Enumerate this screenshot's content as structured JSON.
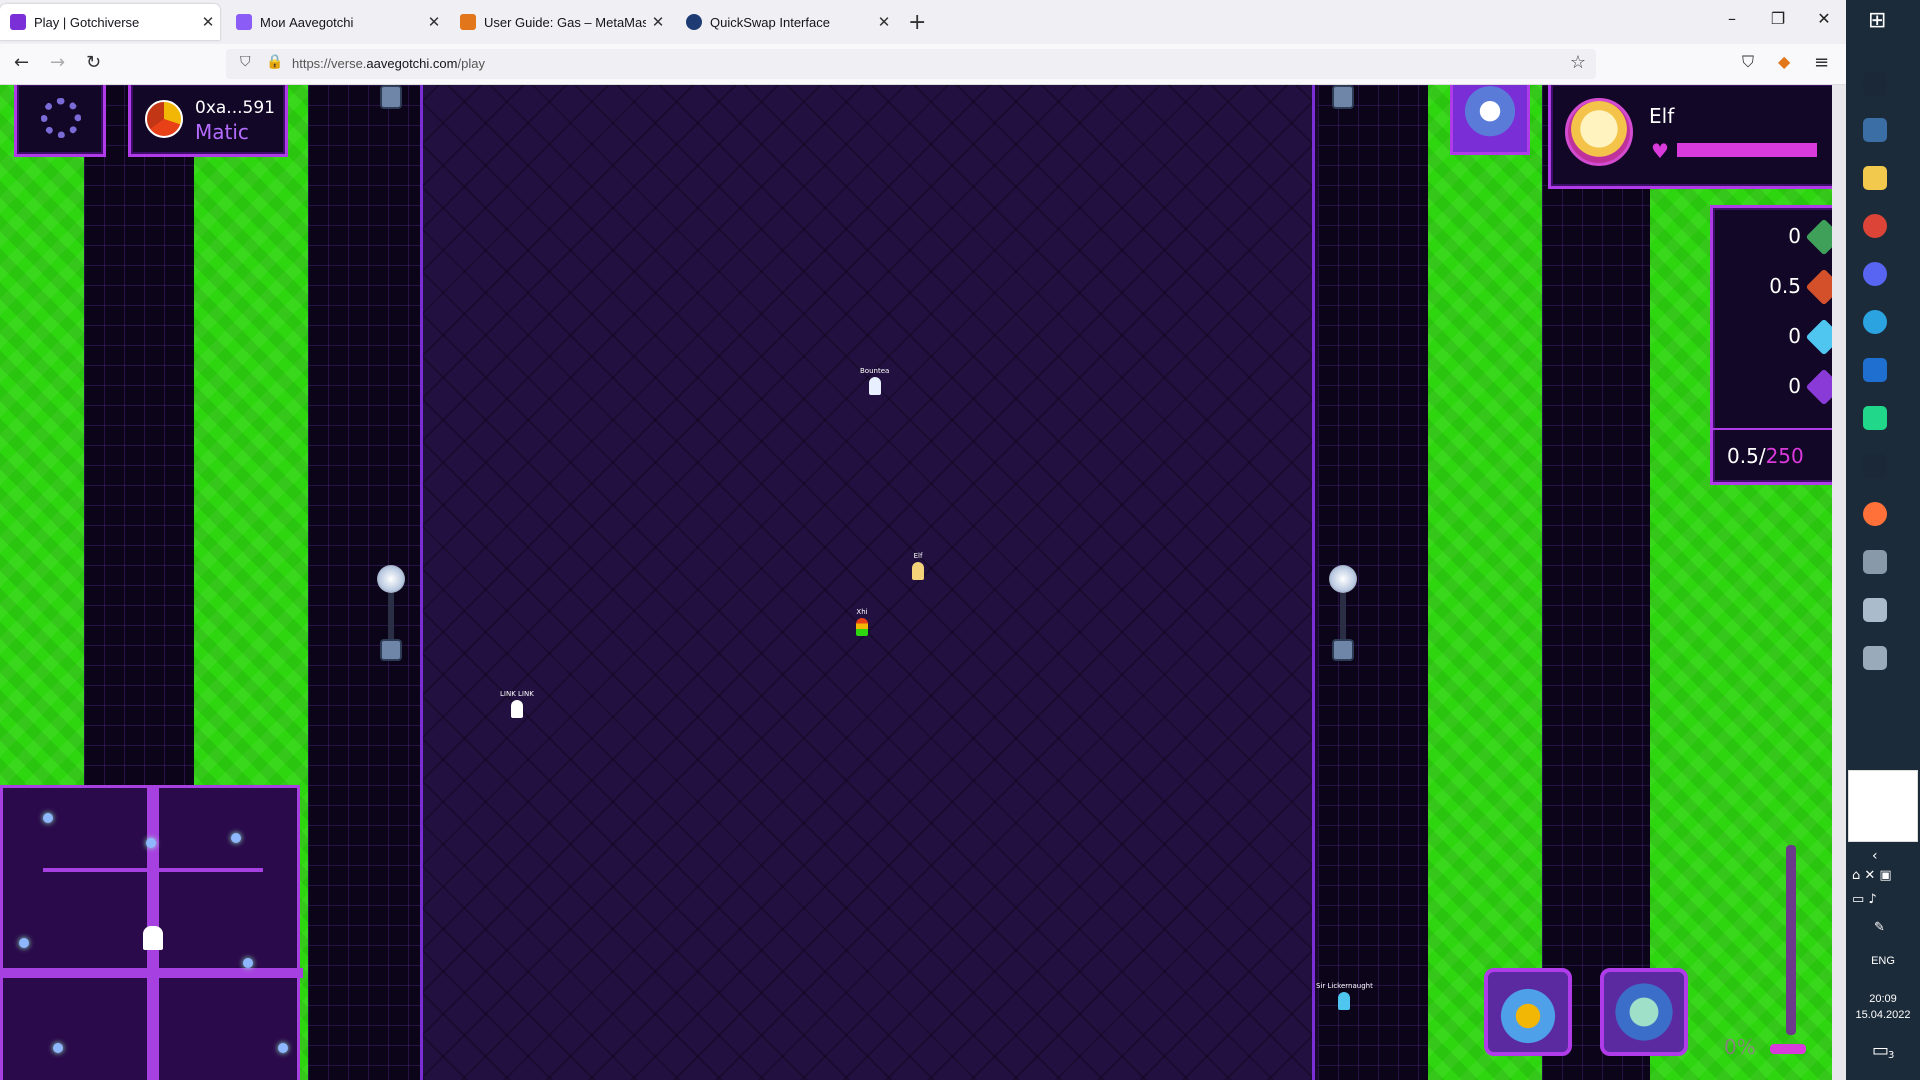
{
  "tabs": [
    {
      "title": "Play | Gotchiverse",
      "fav_color": "#7b2fd6",
      "active": true
    },
    {
      "title": "Мои Aavegotchi",
      "fav_color": "#8b5cf6",
      "active": false
    },
    {
      "title": "User Guide: Gas – MetaMask",
      "fav_color": "#e2761b",
      "active": false
    },
    {
      "title": "QuickSwap Interface",
      "fav_color": "#1f3b73",
      "active": false
    }
  ],
  "new_tab": "+",
  "window_controls": {
    "minimize": "–",
    "restore": "❐",
    "close": "✕"
  },
  "nav": {
    "back": "←",
    "forward": "→",
    "reload": "↻"
  },
  "url": {
    "prefix": "https://verse.",
    "domain": "aavegotchi.com",
    "path": "/play"
  },
  "hud": {
    "wallet_address": "0xa...591",
    "network": "Matic",
    "character_name": "Elf",
    "health_percent": 100,
    "resources": [
      {
        "value": "0",
        "icon": "green-gem-icon",
        "color": "#3fa05a"
      },
      {
        "value": "0.5",
        "icon": "red-gem-icon",
        "color": "#d4502a"
      },
      {
        "value": "0",
        "icon": "blue-gem-icon",
        "color": "#4ec6f0"
      },
      {
        "value": "0",
        "icon": "purple-gem-icon",
        "color": "#8a3ad6"
      }
    ],
    "resource_total": "0.5",
    "resource_capacity": "250",
    "zoom_value": "0%"
  },
  "npcs": [
    {
      "name": "Bountea"
    },
    {
      "name": "Elf"
    },
    {
      "name": "Xhi"
    },
    {
      "name": "LINK LINK"
    },
    {
      "name": "Sir Lickernaught"
    }
  ],
  "taskbar": {
    "language": "ENG",
    "time": "20:09",
    "date": "15.04.2022",
    "notifications": "3"
  }
}
